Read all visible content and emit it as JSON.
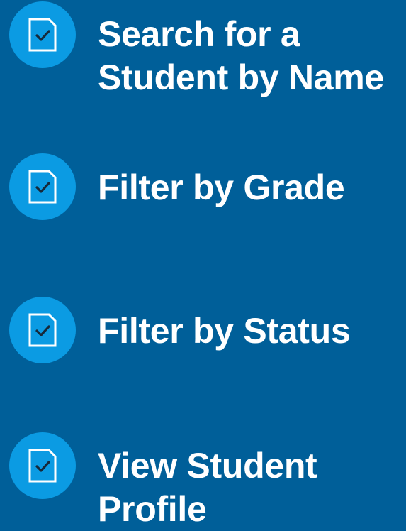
{
  "checklist": {
    "items": [
      {
        "label_line1": "Search for a",
        "label_line2": "Student by Name",
        "icon": "document-check-icon"
      },
      {
        "label_line1": "Filter by Grade",
        "label_line2": "",
        "icon": "document-check-icon"
      },
      {
        "label_line1": "Filter by Status",
        "label_line2": "",
        "icon": "document-check-icon"
      },
      {
        "label_line1": "View Student",
        "label_line2": "Profile",
        "icon": "document-check-icon"
      }
    ]
  },
  "colors": {
    "background": "#005f99",
    "circle": "#0b9be3",
    "text": "#ffffff",
    "icon_stroke": "#ffffff",
    "check": "#16293a"
  }
}
